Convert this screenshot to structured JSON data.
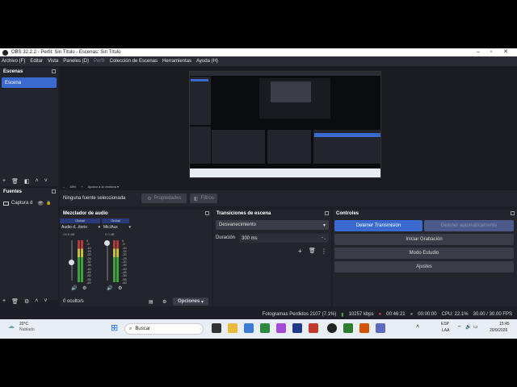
{
  "window": {
    "title": "OBS 32.2.2 - Perfil: Sin Título - Escenas: Sin Título"
  },
  "menu": [
    "Archivo (F)",
    "Editar",
    "Vista",
    "Paneles (D)",
    "Perfil",
    "Colección de Escenas",
    "Herramientas",
    "Ayuda (H)"
  ],
  "scenes": {
    "title": "Escenas",
    "items": [
      "Escena"
    ]
  },
  "sources": {
    "title": "Fuentes",
    "items": [
      "Captura d"
    ]
  },
  "preview": {
    "zoom": "38%",
    "fit_label": "Ajustar a la ventana"
  },
  "source_bar": {
    "none_selected": "Ninguna fuente seleccionada",
    "properties": "Propiedades",
    "filters": "Filtros"
  },
  "mixer": {
    "title": "Mezclador de audio",
    "channels": [
      {
        "tag": "Global",
        "name": "Audio d...itorio",
        "db": "-24.5 dB"
      },
      {
        "tag": "Global",
        "name": "Mic/Aux",
        "db": "0.0 dB"
      }
    ],
    "scale": [
      "0",
      "-5",
      "-10",
      "-15",
      "-20",
      "-25",
      "-30",
      "-35",
      "-40",
      "-45",
      "-50",
      "-55",
      "-60"
    ],
    "hidden": "0 oculto/s",
    "options": "Opciones"
  },
  "transitions": {
    "title": "Transiciones de escena",
    "selected": "Desvanecimiento",
    "duration_label": "Duración",
    "duration_value": "300 ms"
  },
  "controls": {
    "title": "Controles",
    "stop_stream": "Detener Transmisión",
    "stop_auto": "Detener automáticamente",
    "start_recording": "Iniciar Grabación",
    "studio_mode": "Modo Estudio",
    "settings": "Ajustes"
  },
  "status": {
    "dropped": "Fotogramas Perdidos 2107 (7.1%)",
    "bitrate": "10257 kbps",
    "time": "00:46:21",
    "rec_time": "00:00:00",
    "cpu": "CPU: 22.1%",
    "fps": "30.00 / 30.00 FPS"
  },
  "taskbar": {
    "weather_temp": "20°C",
    "weather_desc": "Nublado",
    "search": "Buscar",
    "lang1": "ESP",
    "lang2": "LAA",
    "clock_time": "15:45",
    "clock_date": "20/9/2026"
  },
  "colors": {
    "accent": "#3a6ad0",
    "scene_selected": "#3a6ad0",
    "panel": "#23242c",
    "bg": "#1e1f26"
  }
}
